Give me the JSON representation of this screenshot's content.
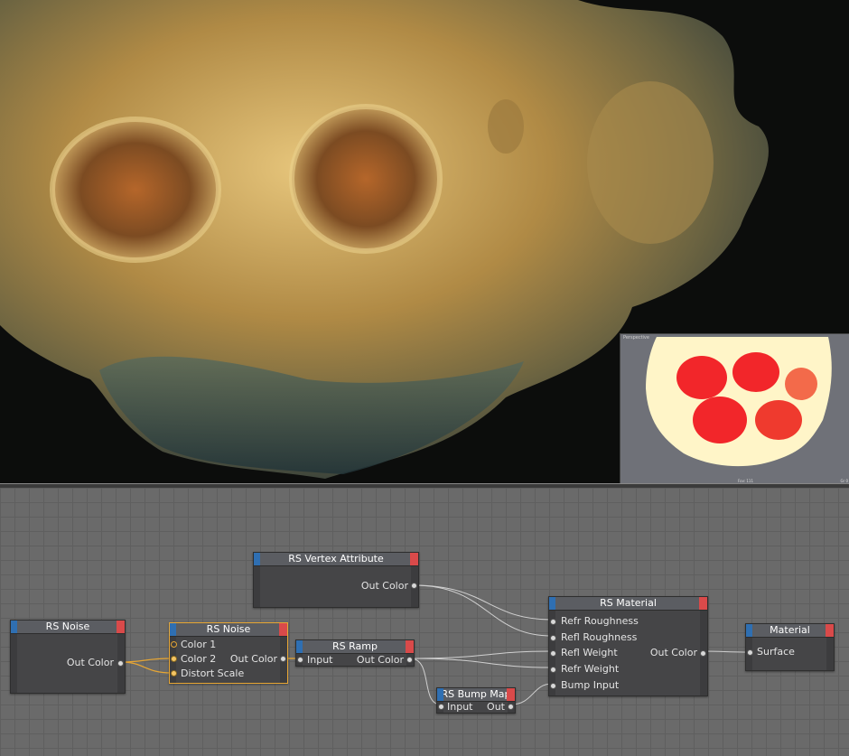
{
  "viewport": {
    "label": "Perspective",
    "stat_left": "Fov: 111",
    "stat_right": "Gr 0"
  },
  "nodes": {
    "noise1": {
      "title": "RS Noise",
      "out": "Out Color"
    },
    "noise2": {
      "title": "RS Noise",
      "in1": "Color 1",
      "in2": "Color 2",
      "in3": "Distort Scale",
      "out": "Out Color"
    },
    "vertex": {
      "title": "RS Vertex Attribute",
      "out": "Out Color"
    },
    "ramp": {
      "title": "RS Ramp",
      "in": "Input",
      "out": "Out Color"
    },
    "bump": {
      "title": "RS Bump Map",
      "in": "Input",
      "out": "Out"
    },
    "material": {
      "title": "RS Material",
      "in1": "Refr Roughness",
      "in2": "Refl Roughness",
      "in3": "Refl Weight",
      "in4": "Refr Weight",
      "in5": "Bump Input",
      "out": "Out Color"
    },
    "output": {
      "title": "Material",
      "in": "Surface"
    }
  },
  "colors": {
    "input_strip": "#2f6fb2",
    "output_strip": "#d94a4a",
    "selection": "#e7a634",
    "wire": "#d0d0d0",
    "wire_selected": "#e7a634"
  }
}
